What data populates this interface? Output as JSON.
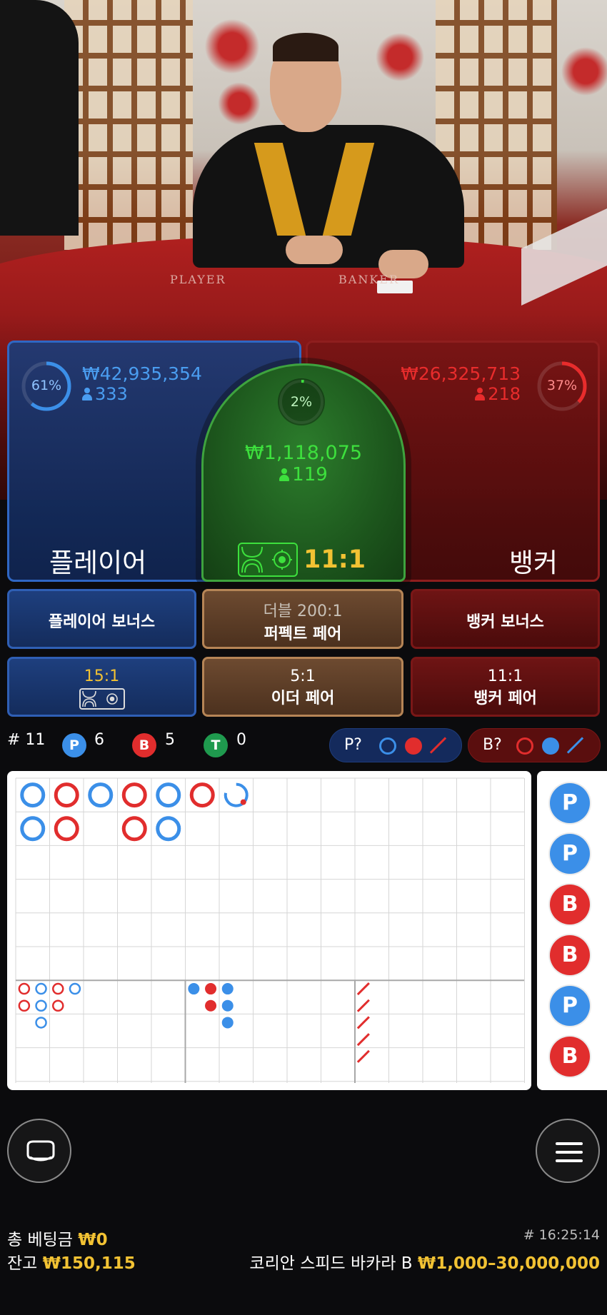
{
  "video": {
    "felt_left": "PLAYER",
    "felt_right": "BANKER"
  },
  "bets": {
    "player": {
      "pct": "61%",
      "pct_value": 0.61,
      "amount": "₩42,935,354",
      "count": "333",
      "label": "플레이어",
      "color": "#3b8fe8"
    },
    "banker": {
      "pct": "37%",
      "pct_value": 0.37,
      "amount": "₩26,325,713",
      "count": "218",
      "label": "뱅커",
      "color": "#e82c2c"
    },
    "tie": {
      "pct": "2%",
      "pct_value": 0.02,
      "amount": "₩1,118,075",
      "count": "119",
      "payout": "11:1",
      "color": "#3de03d"
    }
  },
  "side_bets": {
    "player_bonus": "플레이어 보너스",
    "perfect_pair_top": "더블 200:1",
    "perfect_pair": "퍼펙트 페어",
    "banker_bonus": "뱅커 보너스",
    "player_pair_payout": "15:1",
    "either_pair_payout": "5:1",
    "either_pair": "이더 페어",
    "banker_pair_payout": "11:1",
    "banker_pair": "뱅커 페어"
  },
  "stats": {
    "round": "# 11",
    "p_letter": "P",
    "p_count": "6",
    "b_letter": "B",
    "b_count": "5",
    "t_letter": "T",
    "t_count": "0",
    "p_predict": "P?",
    "b_predict": "B?"
  },
  "road": {
    "big_road": [
      {
        "col": 0,
        "row": 0,
        "r": "P"
      },
      {
        "col": 0,
        "row": 1,
        "r": "P"
      },
      {
        "col": 1,
        "row": 0,
        "r": "B"
      },
      {
        "col": 1,
        "row": 1,
        "r": "B"
      },
      {
        "col": 2,
        "row": 0,
        "r": "P"
      },
      {
        "col": 3,
        "row": 0,
        "r": "B"
      },
      {
        "col": 3,
        "row": 1,
        "r": "B"
      },
      {
        "col": 4,
        "row": 0,
        "r": "P"
      },
      {
        "col": 4,
        "row": 1,
        "r": "P"
      },
      {
        "col": 5,
        "row": 0,
        "r": "B"
      },
      {
        "col": 6,
        "row": 0,
        "r": "P-partial"
      }
    ],
    "big_eye": [
      [
        "B",
        "P",
        "B",
        "P"
      ],
      [
        "B",
        "P",
        "B",
        ""
      ],
      [
        "",
        "P",
        "",
        ""
      ]
    ],
    "small_road": [
      [
        "P",
        "B",
        "P"
      ],
      [
        "",
        "B",
        "P"
      ],
      [
        "",
        "",
        "P"
      ]
    ],
    "cockroach_count": 5,
    "side_road": [
      "P",
      "P",
      "B",
      "B",
      "P",
      "B"
    ]
  },
  "colors": {
    "player": "#3b8fe8",
    "banker": "#e12d2d",
    "tie": "#1f9a4e"
  },
  "bottom": {
    "total_bet_label": "총 베팅금",
    "total_bet": "₩0",
    "balance_label": "잔고",
    "balance": "₩150,115",
    "time": "# 16:25:14",
    "table_name": "코리안 스피드 바카라 B",
    "limits": "₩1,000–30,000,000"
  }
}
